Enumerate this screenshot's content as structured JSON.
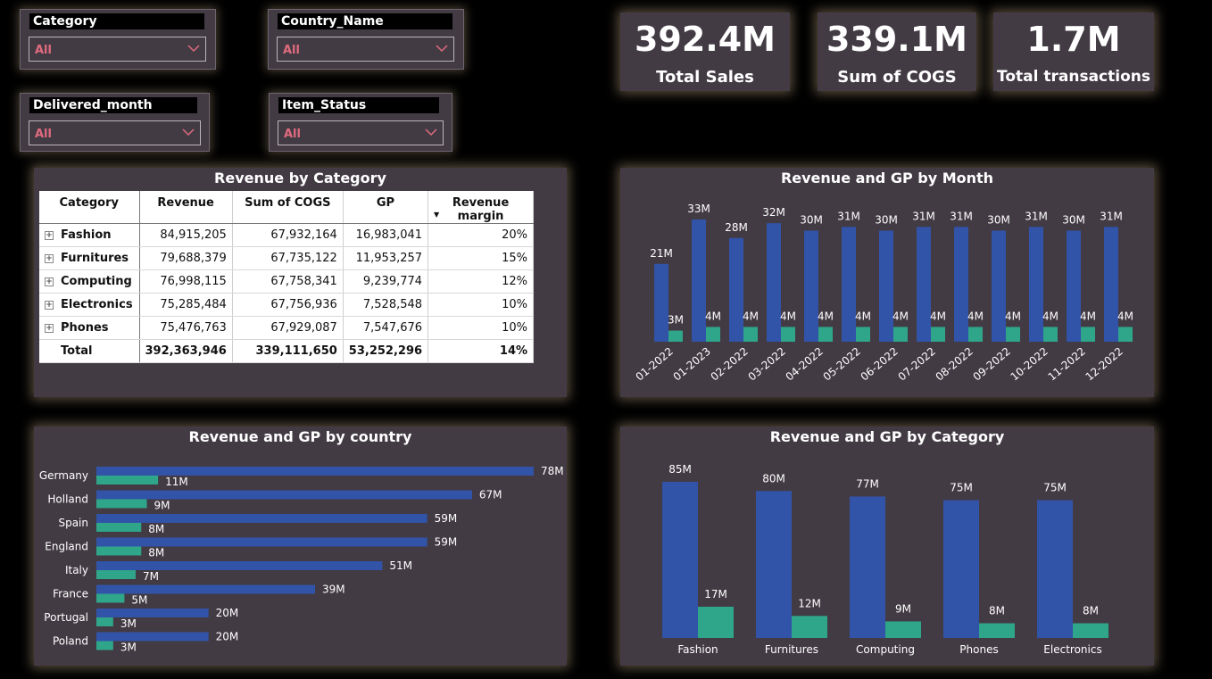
{
  "slicers": {
    "category": {
      "title": "Category",
      "value": "All"
    },
    "country": {
      "title": "Country_Name",
      "value": "All"
    },
    "month": {
      "title": "Delivered_month",
      "value": "All"
    },
    "status": {
      "title": "Item_Status",
      "value": "All"
    }
  },
  "kpis": {
    "sales": {
      "value": "392.4M",
      "label": "Total Sales"
    },
    "cogs": {
      "value": "339.1M",
      "label": "Sum of COGS"
    },
    "transactions": {
      "value": "1.7M",
      "label": "Total transactions"
    }
  },
  "colors": {
    "revenue": "#3153a8",
    "gp": "#2fa58a",
    "card": "#433b44",
    "slicer_value": "#e06b7e"
  },
  "table": {
    "title": "Revenue by Category",
    "headers": [
      "Category",
      "Revenue",
      "Sum of COGS",
      "GP",
      "Revenue margin"
    ],
    "rows": [
      [
        "Fashion",
        "84,915,205",
        "67,932,164",
        "16,983,041",
        "20%"
      ],
      [
        "Furnitures",
        "79,688,379",
        "67,735,122",
        "11,953,257",
        "15%"
      ],
      [
        "Computing",
        "76,998,115",
        "67,758,341",
        "9,239,774",
        "12%"
      ],
      [
        "Electronics",
        "75,285,484",
        "67,756,936",
        "7,528,548",
        "10%"
      ],
      [
        "Phones",
        "75,476,763",
        "67,929,087",
        "7,547,676",
        "10%"
      ]
    ],
    "total": [
      "Total",
      "392,363,946",
      "339,111,650",
      "53,252,296",
      "14%"
    ]
  },
  "chart_data": [
    {
      "type": "bar",
      "title": "Revenue and GP by Month",
      "categories": [
        "01-2022",
        "01-2023",
        "02-2022",
        "03-2022",
        "04-2022",
        "05-2022",
        "06-2022",
        "07-2022",
        "08-2022",
        "09-2022",
        "10-2022",
        "11-2022",
        "12-2022"
      ],
      "series": [
        {
          "values": [
            21,
            33,
            28,
            32,
            30,
            31,
            30,
            31,
            31,
            30,
            31,
            30,
            31
          ],
          "labels": [
            "21M",
            "33M",
            "28M",
            "32M",
            "30M",
            "31M",
            "30M",
            "31M",
            "31M",
            "30M",
            "31M",
            "30M",
            "31M"
          ]
        },
        {
          "values": [
            3,
            4,
            4,
            4,
            4,
            4,
            4,
            4,
            4,
            4,
            4,
            4,
            4
          ],
          "labels": [
            "3M",
            "4M",
            "4M",
            "4M",
            "4M",
            "4M",
            "4M",
            "4M",
            "4M",
            "4M",
            "4M",
            "4M",
            "4M"
          ]
        }
      ],
      "ylim": [
        0,
        33
      ]
    },
    {
      "type": "bar",
      "orientation": "horizontal",
      "title": "Revenue and GP by country",
      "categories": [
        "Germany",
        "Holland",
        "Spain",
        "England",
        "Italy",
        "France",
        "Portugal",
        "Poland"
      ],
      "series": [
        {
          "values": [
            78,
            67,
            59,
            59,
            51,
            39,
            20,
            20
          ],
          "labels": [
            "78M",
            "67M",
            "59M",
            "59M",
            "51M",
            "39M",
            "20M",
            "20M"
          ]
        },
        {
          "values": [
            11,
            9,
            8,
            8,
            7,
            5,
            3,
            3
          ],
          "labels": [
            "11M",
            "9M",
            "8M",
            "8M",
            "7M",
            "5M",
            "3M",
            "3M"
          ]
        }
      ],
      "xlim": [
        0,
        78
      ]
    },
    {
      "type": "bar",
      "title": "Revenue and GP by Category",
      "categories": [
        "Fashion",
        "Furnitures",
        "Computing",
        "Phones",
        "Electronics"
      ],
      "series": [
        {
          "values": [
            85,
            80,
            77,
            75,
            75
          ],
          "labels": [
            "85M",
            "80M",
            "77M",
            "75M",
            "75M"
          ]
        },
        {
          "values": [
            17,
            12,
            9,
            8,
            8
          ],
          "labels": [
            "17M",
            "12M",
            "9M",
            "8M",
            "8M"
          ]
        }
      ],
      "ylim": [
        0,
        85
      ]
    }
  ]
}
